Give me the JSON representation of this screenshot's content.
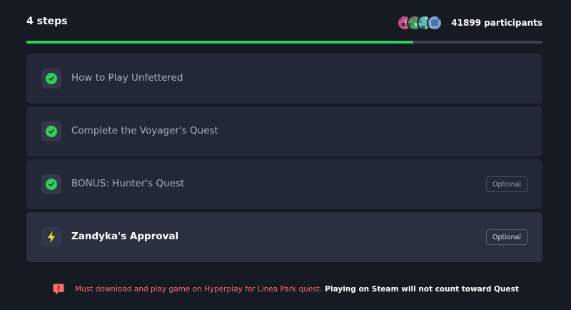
{
  "header": {
    "steps_label": "4 steps",
    "participants_label": "41899 participants",
    "avatars": [
      {
        "name": "avatar-pink-pixel-icon",
        "colors": [
          "#c84f8a",
          "#6a3d5c",
          "#e58bb6",
          "#3a2a3a"
        ]
      },
      {
        "name": "avatar-green-pixel-icon",
        "colors": [
          "#3ea45f",
          "#b84c7a",
          "#2c6e45",
          "#d8d8d8"
        ]
      },
      {
        "name": "avatar-teal-pixel-icon",
        "colors": [
          "#5fb8b0",
          "#3a7f9a",
          "#9ad2cc",
          "#2a4b5a"
        ]
      },
      {
        "name": "avatar-blue-pixel-icon",
        "colors": [
          "#7aa3d6",
          "#4f6fa8",
          "#c9d9ef",
          "#2f3f66"
        ]
      }
    ]
  },
  "progress": {
    "fraction": 0.75,
    "color": "#2fd05a"
  },
  "steps": [
    {
      "title": "How to Play Unfettered",
      "status": "complete",
      "badge": ""
    },
    {
      "title": "Complete the Voyager's Quest",
      "status": "complete",
      "badge": ""
    },
    {
      "title": "BONUS: Hunter's Quest",
      "status": "complete",
      "badge": "Optional"
    },
    {
      "title": "Zandyka's Approval",
      "status": "active",
      "badge": "Optional"
    }
  ],
  "notice": {
    "text": "Must download and play game on Hyperplay for Linea Park quest.",
    "strong_text": "Playing on Steam will not count toward Quest",
    "icon": "alert-speech-bubble-icon",
    "color": "#ff6b6b"
  }
}
